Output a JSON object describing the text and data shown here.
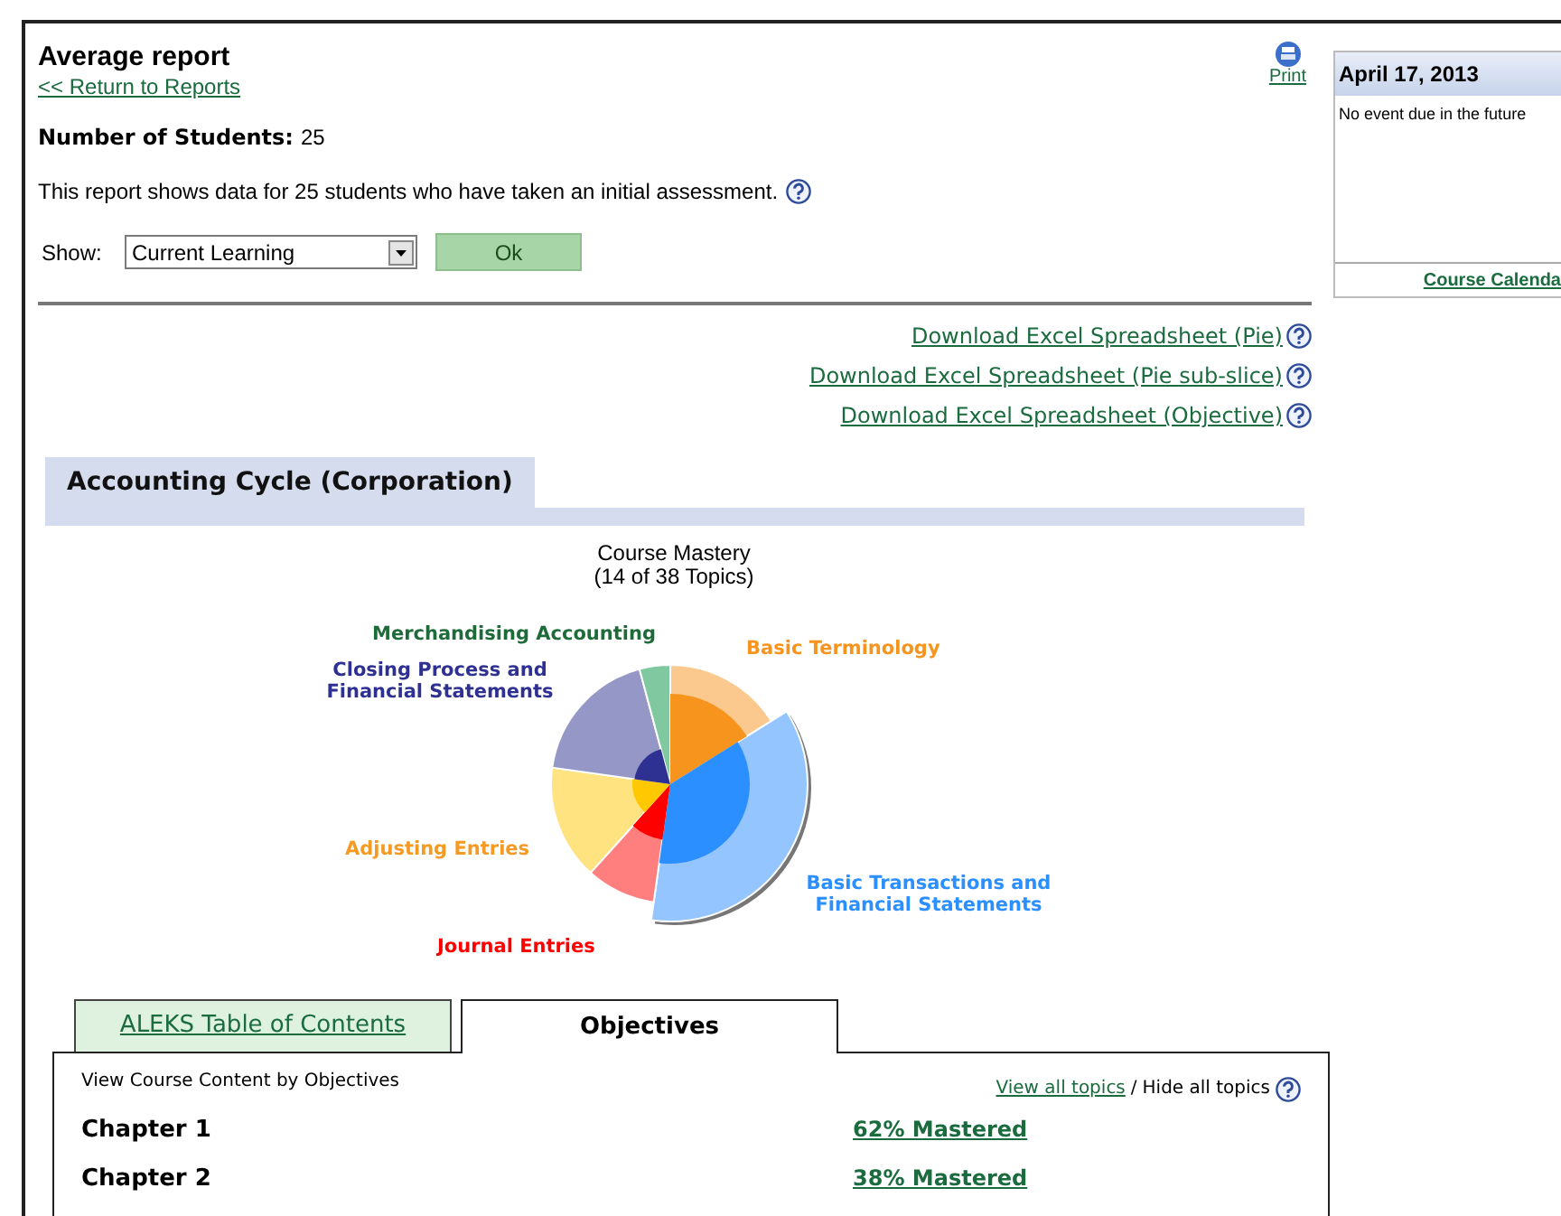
{
  "header": {
    "title": "Average report",
    "back_link": "<< Return to Reports",
    "print": "Print"
  },
  "students": {
    "label": "Number of Students:",
    "value": "25"
  },
  "description": "This report shows data for 25 students who have taken an initial assessment.",
  "show": {
    "label": "Show:",
    "value": "Current Learning",
    "button": "Ok"
  },
  "downloads": [
    "Download Excel Spreadsheet (Pie)",
    "Download Excel Spreadsheet (Pie sub-slice)",
    "Download Excel Spreadsheet (Objective)"
  ],
  "section_title": "Accounting Cycle (Corporation)",
  "chart": {
    "title": "Course Mastery",
    "subtitle": "(14 of 38 Topics)",
    "labels": [
      {
        "text": "Merchandising Accounting",
        "color": "#1e6b3a"
      },
      {
        "text": "Closing Process and Financial Statements",
        "color": "#2e3192"
      },
      {
        "text": "Basic Terminology",
        "color": "#f7941d"
      },
      {
        "text": "Adjusting Entries",
        "color": "#f59a23"
      },
      {
        "text": "Basic Transactions and Financial Statements",
        "color": "#2b8fff"
      },
      {
        "text": "Journal Entries",
        "color": "#ff0000"
      }
    ]
  },
  "tabs": [
    {
      "label": "ALEKS Table of Contents",
      "selected": false
    },
    {
      "label": "Objectives",
      "selected": true
    }
  ],
  "objectives": {
    "caption": "View Course Content by Objectives",
    "view_all": "View all topics",
    "separator": "/",
    "hide_all": "Hide all topics",
    "chapters": [
      {
        "name": "Chapter 1",
        "mastery": "62% Mastered"
      },
      {
        "name": "Chapter 2",
        "mastery": "38% Mastered"
      }
    ]
  },
  "calendar": {
    "date": "April 17, 2013",
    "message": "No event due in the future",
    "link": "Course Calenda"
  }
}
